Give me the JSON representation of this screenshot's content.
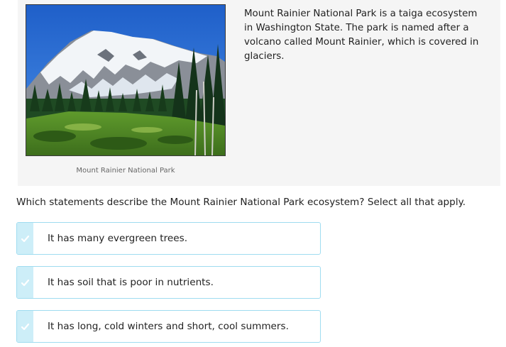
{
  "passage": {
    "image": {
      "name": "Mount Rainier photo",
      "caption": "Mount Rainier National Park"
    },
    "text": "Mount Rainier National Park is a taiga ecosystem in Washington State. The park is named after a volcano called Mount Rainier, which is covered in glaciers."
  },
  "question": {
    "prompt": "Which statements describe the Mount Rainier National Park ecosystem? Select all that apply."
  },
  "options": [
    {
      "label": "It has many evergreen trees.",
      "selected": false
    },
    {
      "label": "It has soil that is poor in nutrients.",
      "selected": false
    },
    {
      "label": "It has long, cold winters and short, cool summers.",
      "selected": false
    }
  ],
  "colors": {
    "option_border": "#9fdcf0",
    "check_strip": "#cdeef8",
    "card_background": "#f5f5f5"
  }
}
